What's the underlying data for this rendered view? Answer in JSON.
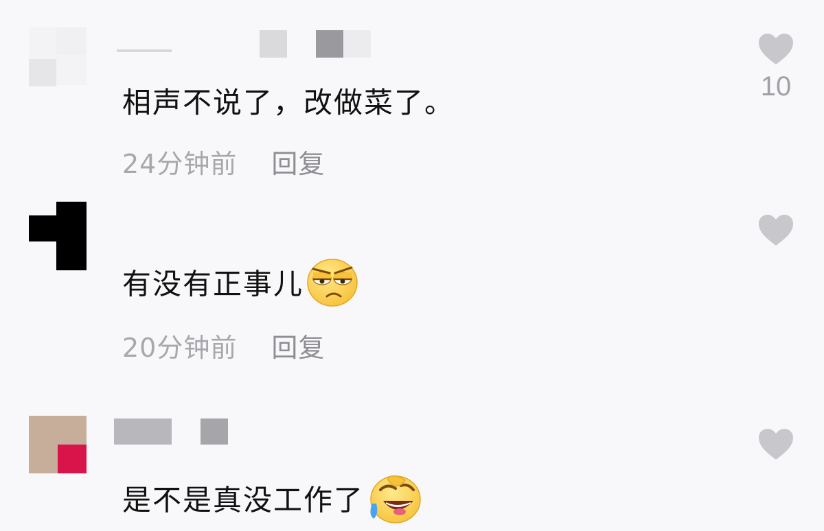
{
  "comments": [
    {
      "text": "相声不说了，改做菜了。",
      "time": "24分钟前",
      "reply": "回复",
      "likes": "10"
    },
    {
      "text": "有没有正事儿",
      "time": "20分钟前",
      "reply": "回复",
      "likes": "",
      "emoji": "skeptical-face-icon"
    },
    {
      "text": "是不是真没工作了",
      "time": "",
      "reply": "",
      "likes": "",
      "emoji": "rolling-laughing-face-icon"
    }
  ],
  "colors": {
    "background": "#f8f8fa",
    "text": "#111111",
    "meta": "#a8a8ac",
    "heart": "#c8c8cc"
  }
}
